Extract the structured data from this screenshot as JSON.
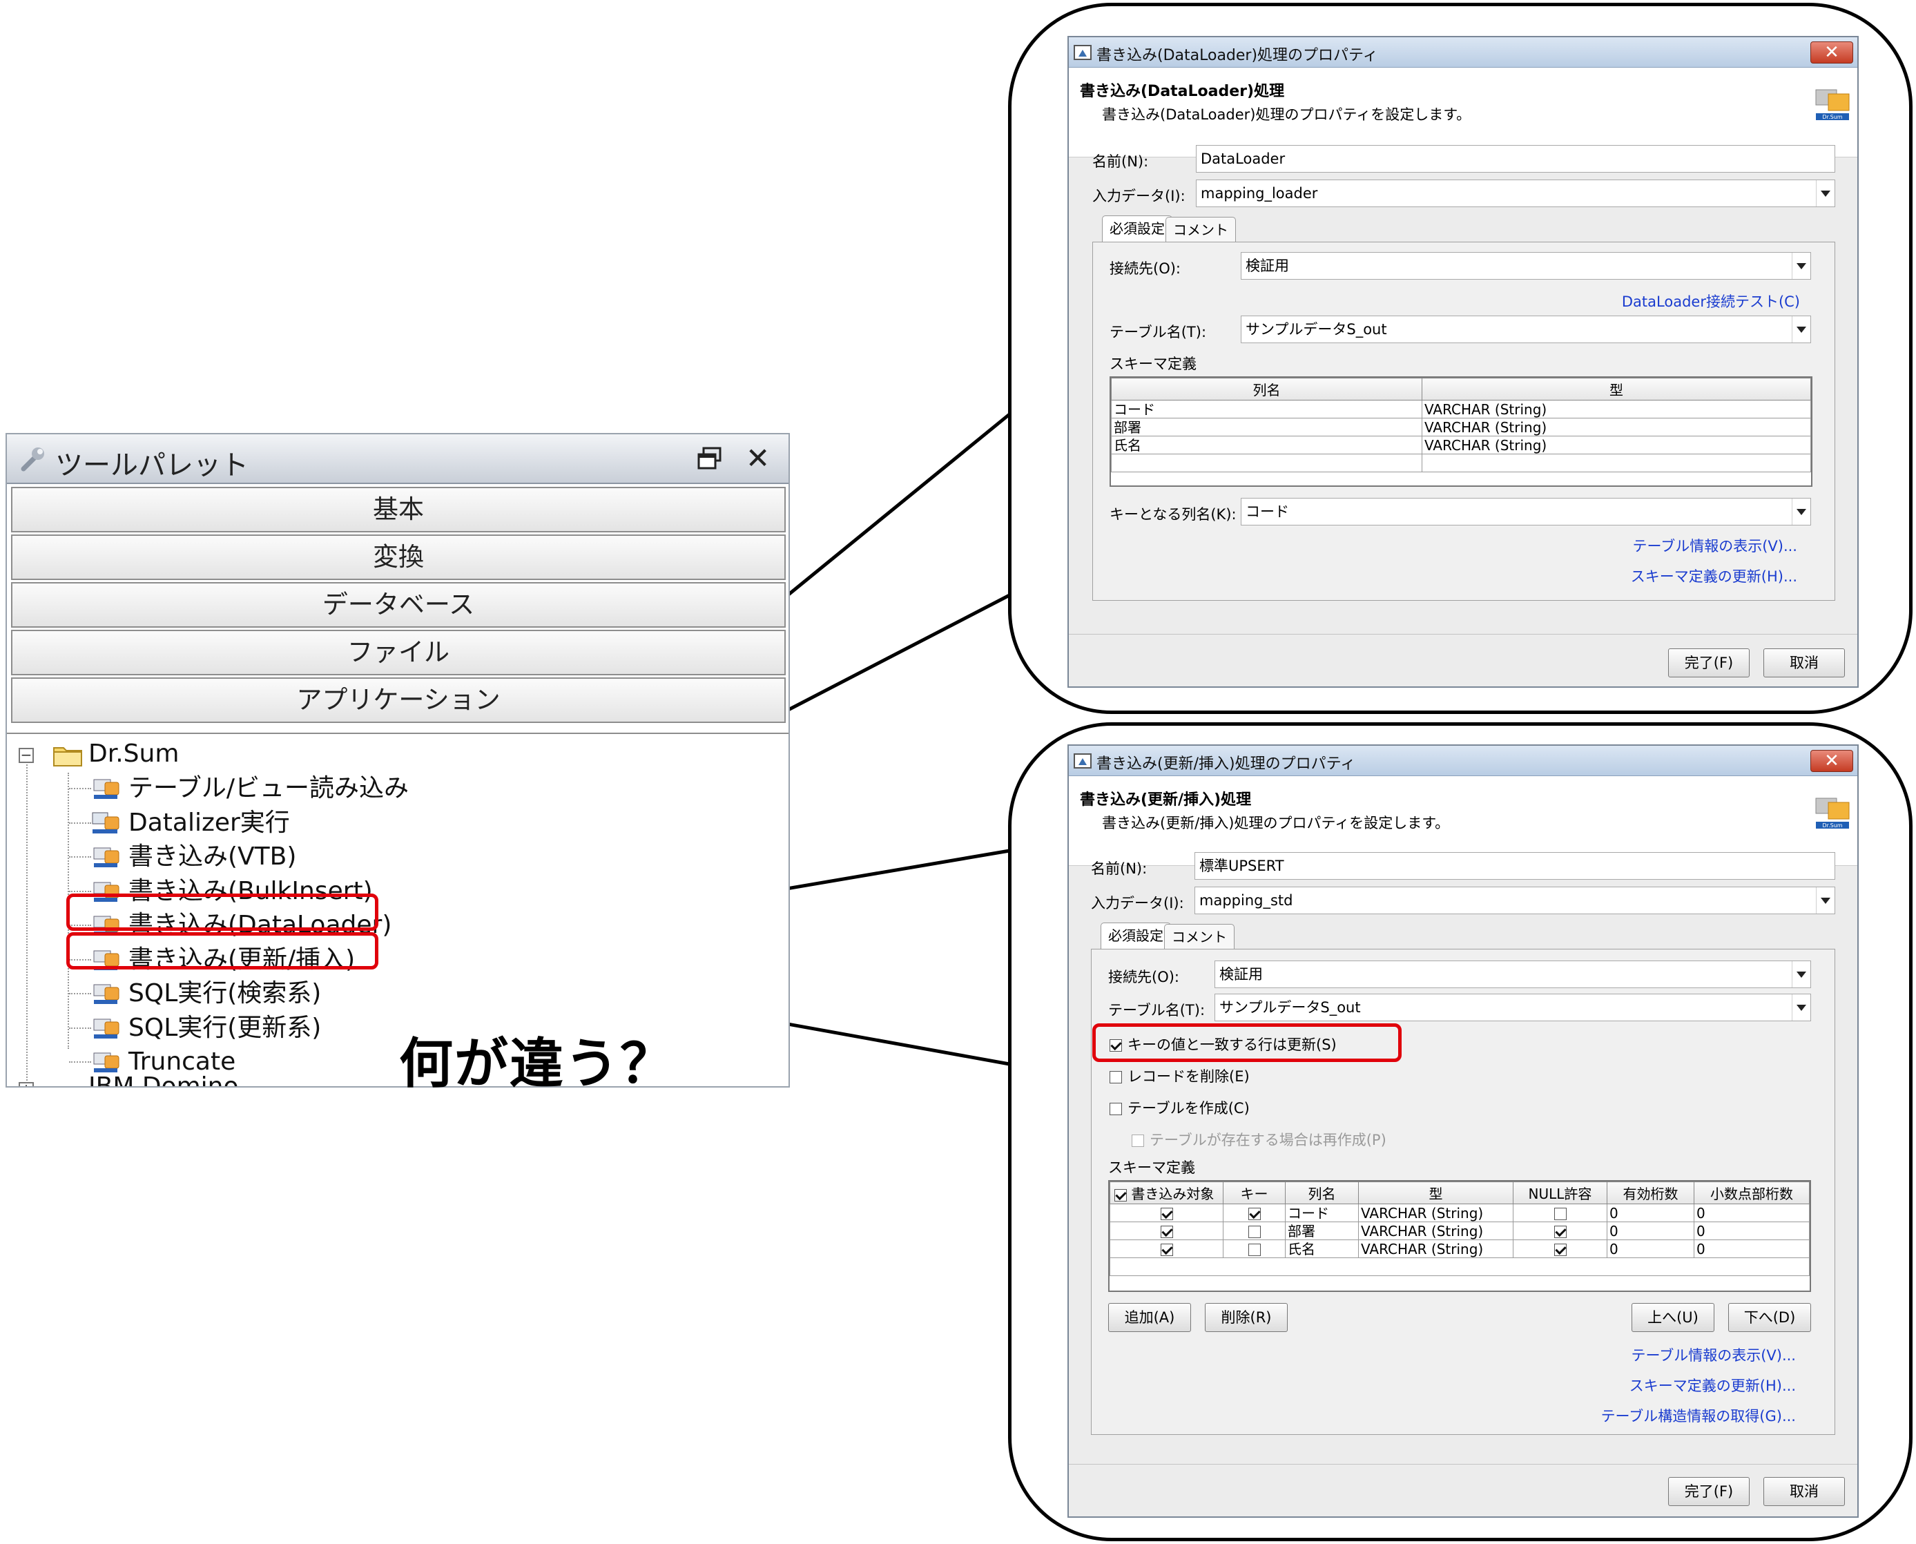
{
  "palette": {
    "title": "ツールパレット",
    "categories": [
      "基本",
      "変換",
      "データベース",
      "ファイル",
      "アプリケーション"
    ],
    "tree_root": "Dr.Sum",
    "tree_items": [
      "テーブル/ビュー読み込み",
      "Datalizer実行",
      "書き込み(VTB)",
      "書き込み(BulkInsert)",
      "書き込み(DataLoader)",
      "書き込み(更新/挿入)",
      "SQL実行(検索系)",
      "SQL実行(更新系)",
      "Truncate"
    ],
    "tree_next_root": "IBM Domino"
  },
  "question": "何が違う？",
  "dialog1": {
    "title": "書き込み(DataLoader)処理のプロパティ",
    "header_title": "書き込み(DataLoader)処理",
    "header_desc": "書き込み(DataLoader)処理のプロパティを設定します。",
    "logo_text": "Dr.Sum",
    "name_label": "名前(N):",
    "name_value": "DataLoader",
    "input_label": "入力データ(I):",
    "input_value": "mapping_loader",
    "tab_required": "必須設定",
    "tab_comment": "コメント",
    "conn_label": "接続先(O):",
    "conn_value": "検証用",
    "conn_test_link": "DataLoader接続テスト(C)",
    "table_label": "テーブル名(T):",
    "table_value": "サンプルデータS_out",
    "schema_label": "スキーマ定義",
    "columns": [
      "列名",
      "型"
    ],
    "rows": [
      [
        "コード",
        "VARCHAR (String)"
      ],
      [
        "部署",
        "VARCHAR (String)"
      ],
      [
        "氏名",
        "VARCHAR (String)"
      ]
    ],
    "key_label": "キーとなる列名(K):",
    "key_value": "コード",
    "link_table_info": "テーブル情報の表示(V)...",
    "link_schema_update": "スキーマ定義の更新(H)...",
    "ok": "完了(F)",
    "cancel": "取消"
  },
  "dialog2": {
    "title": "書き込み(更新/挿入)処理のプロパティ",
    "header_title": "書き込み(更新/挿入)処理",
    "header_desc": "書き込み(更新/挿入)処理のプロパティを設定します。",
    "logo_text": "Dr.Sum",
    "name_label": "名前(N):",
    "name_value": "標準UPSERT",
    "input_label": "入力データ(I):",
    "input_value": "mapping_std",
    "tab_required": "必須設定",
    "tab_comment": "コメント",
    "conn_label": "接続先(O):",
    "conn_value": "検証用",
    "table_label": "テーブル名(T):",
    "table_value": "サンプルデータS_out",
    "opt_update": "キーの値と一致する行は更新(S)",
    "opt_delete": "レコードを削除(E)",
    "opt_create": "テーブルを作成(C)",
    "opt_recreate": "テーブルが存在する場合は再作成(P)",
    "schema_label": "スキーマ定義",
    "columns": [
      "書き込み対象",
      "キー",
      "列名",
      "型",
      "NULL許容",
      "有効桁数",
      "小数点部桁数"
    ],
    "rows": [
      {
        "write": true,
        "key": true,
        "name": "コード",
        "type": "VARCHAR (String)",
        "nullable": false,
        "digits": "0",
        "decimals": "0"
      },
      {
        "write": true,
        "key": false,
        "name": "部署",
        "type": "VARCHAR (String)",
        "nullable": true,
        "digits": "0",
        "decimals": "0"
      },
      {
        "write": true,
        "key": false,
        "name": "氏名",
        "type": "VARCHAR (String)",
        "nullable": true,
        "digits": "0",
        "decimals": "0"
      }
    ],
    "btn_add": "追加(A)",
    "btn_delete": "削除(R)",
    "btn_up": "上へ(U)",
    "btn_down": "下へ(D)",
    "link_table_info": "テーブル情報の表示(V)...",
    "link_schema_update": "スキーマ定義の更新(H)...",
    "link_table_struct": "テーブル構造情報の取得(G)...",
    "ok": "完了(F)",
    "cancel": "取消"
  }
}
